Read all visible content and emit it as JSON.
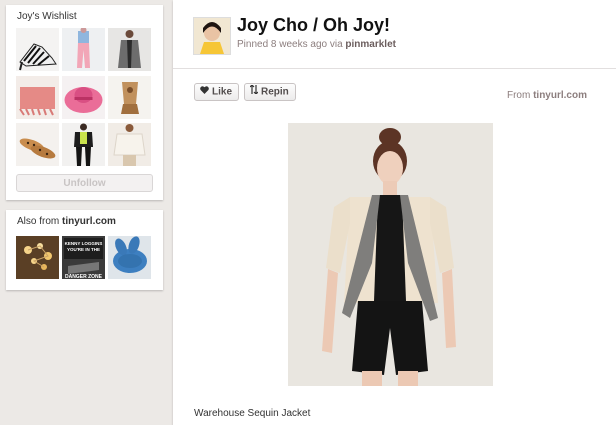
{
  "sidebar": {
    "wishlist": {
      "title": "Joy's Wishlist",
      "unfollow_label": "Unfollow",
      "thumbnails": [
        "striped-heel-shoe",
        "pink-pants-outfit",
        "gray-cardigan-outfit",
        "pink-fringe-clutch",
        "pink-sun-hat",
        "tan-wedge-sandal",
        "leopard-flat-shoes",
        "black-jacket-lime-top",
        "white-blouse-outfit"
      ]
    },
    "also_from": {
      "prefix": "Also from",
      "domain": "tinyurl.com",
      "thumbnails": [
        "chandelier-lights",
        "danger-zone-meme",
        "blue-knit-bunny"
      ],
      "meme_text": "KENNY LOGGINS\nYOU'RE IN THE\nDANGER ZONE"
    }
  },
  "pin": {
    "title": "Joy Cho / Oh Joy!",
    "pinned_text": "Pinned 8 weeks ago via",
    "pinned_via": "pinmarklet",
    "like_label": "Like",
    "repin_label": "Repin",
    "from_prefix": "From",
    "from_domain": "tinyurl.com",
    "caption": "Warehouse Sequin Jacket"
  },
  "colors": {
    "page_background": "#ece9e6",
    "card_background": "#ffffff",
    "muted_text": "#8c7e7e"
  }
}
